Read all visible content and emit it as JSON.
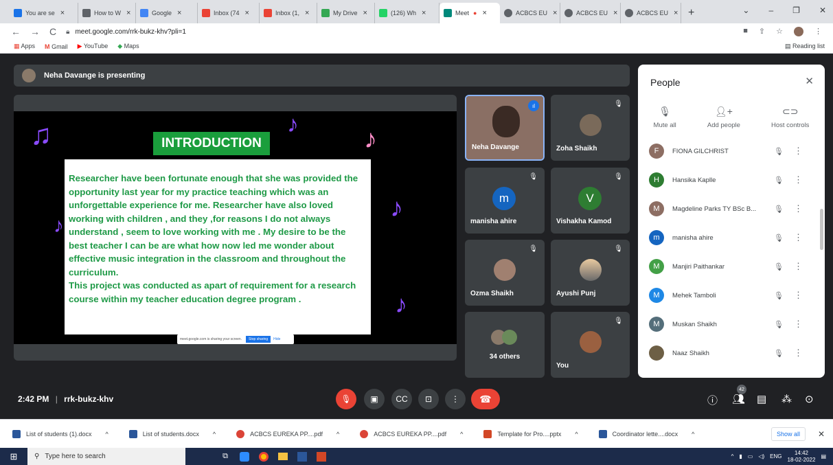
{
  "browser": {
    "tabs": [
      {
        "label": "You are se",
        "color": "#1a73e8"
      },
      {
        "label": "How to W",
        "color": "#5f6368"
      },
      {
        "label": "Google",
        "color": "#4285f4"
      },
      {
        "label": "Inbox (74",
        "color": "#ea4335"
      },
      {
        "label": "Inbox (1,",
        "color": "#ea4335"
      },
      {
        "label": "My Drive",
        "color": "#34a853"
      },
      {
        "label": "(126) Wh",
        "color": "#25d366"
      },
      {
        "label": "Meet",
        "color": "#00897b"
      },
      {
        "label": "ACBCS EU",
        "color": "#5f6368"
      },
      {
        "label": "ACBCS EU",
        "color": "#5f6368"
      },
      {
        "label": "ACBCS EU",
        "color": "#5f6368"
      }
    ],
    "url": "meet.google.com/rrk-bukz-khv?pli=1",
    "bookmarks": [
      "Apps",
      "Gmail",
      "YouTube",
      "Maps"
    ],
    "reading_list": "Reading list"
  },
  "meet": {
    "presenting_banner": "Neha Davange is presenting",
    "slide": {
      "title": "INTRODUCTION",
      "body": "Researcher have been fortunate enough that she was provided the opportunity last year for my practice teaching which was an unforgettable experience for me. Researcher have also loved working with children , and they ,for reasons I do not always understand , seem to love working with me . My desire to be the best teacher I can be are what how now led me wonder about effective music integration in the classroom and throughout the curriculum.",
      "body2": "This project was conducted as apart of requirement for a research course within my teacher education degree program .",
      "share_text": "meet.google.com is sharing your screen.",
      "share_stop": "Stop sharing",
      "share_hide": "Hide"
    },
    "tiles": [
      {
        "name": "Neha Davange"
      },
      {
        "name": "Zoha Shaikh"
      },
      {
        "name": "manisha ahire",
        "letter": "m",
        "color": "#1565c0"
      },
      {
        "name": "Vishakha Kamod",
        "letter": "V",
        "color": "#2e7d32"
      },
      {
        "name": "Ozma Shaikh"
      },
      {
        "name": "Ayushi Punj"
      },
      {
        "name": "34 others"
      },
      {
        "name": "You"
      }
    ],
    "people_panel": {
      "title": "People",
      "actions": [
        "Mute all",
        "Add people",
        "Host controls"
      ],
      "list": [
        {
          "name": "FIONA GILCHRIST",
          "letter": "F",
          "color": "#8d6e63"
        },
        {
          "name": "Hansika Kaplle",
          "letter": "H",
          "color": "#2e7d32"
        },
        {
          "name": "Magdeline Parks TY BSc B...",
          "letter": "M",
          "color": "#8d6e63"
        },
        {
          "name": "manisha ahire",
          "letter": "m",
          "color": "#1565c0"
        },
        {
          "name": "Manjiri Paithankar",
          "letter": "M",
          "color": "#43a047"
        },
        {
          "name": "Mehek Tamboli",
          "letter": "M",
          "color": "#1e88e5"
        },
        {
          "name": "Muskan Shaikh",
          "letter": "M",
          "color": "#546e7a"
        },
        {
          "name": "Naaz Shaikh",
          "letter": "",
          "color": "#6d5f45"
        }
      ]
    },
    "bottom": {
      "time": "2:42 PM",
      "separator": "|",
      "meeting_code": "rrk-bukz-khv",
      "participant_count": "42"
    }
  },
  "downloads": [
    {
      "label": "List of students (1).docx",
      "color": "#2b579a"
    },
    {
      "label": "List of students.docx",
      "color": "#2b579a"
    },
    {
      "label": "ACBCS EUREKA PP....pdf",
      "color": "#db4437"
    },
    {
      "label": "ACBCS EUREKA PP....pdf",
      "color": "#db4437"
    },
    {
      "label": "Template for Pro....pptx",
      "color": "#d24726"
    },
    {
      "label": "Coordinator lette....docx",
      "color": "#2b579a"
    }
  ],
  "show_all": "Show all",
  "taskbar": {
    "search_placeholder": "Type here to search",
    "language": "ENG",
    "time": "14:42",
    "date": "18-02-2022"
  }
}
